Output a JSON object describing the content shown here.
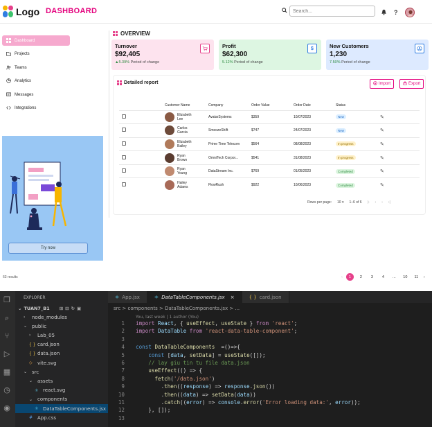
{
  "app": {
    "logo_text": "Logo",
    "page_title": "DASHBOARD",
    "search": {
      "placeholder": "Search..."
    },
    "colors": {
      "accent": "#e4007c",
      "active_nav": "#f6a9ce",
      "promo_bg": "#99c7f4"
    }
  },
  "sidebar": {
    "items": [
      {
        "label": "Dashboard",
        "icon": "grid-icon",
        "active": true
      },
      {
        "label": "Projects",
        "icon": "folder-icon"
      },
      {
        "label": "Teams",
        "icon": "users-icon"
      },
      {
        "label": "Analytics",
        "icon": "pie-chart-icon"
      },
      {
        "label": "Messages",
        "icon": "message-icon"
      },
      {
        "label": "Integrations",
        "icon": "code-icon"
      }
    ],
    "promo_button": "Try now"
  },
  "overview": {
    "title": "OVERVIEW",
    "cards": [
      {
        "title": "Turnover",
        "value": "$92,405",
        "change": "▲5.39%",
        "change_note": "Period of change",
        "icon": "cart-icon",
        "bg": "#fde3ee",
        "change_color": "#2b8a3e"
      },
      {
        "title": "Profit",
        "value": "$62,300",
        "change": "5.12%",
        "change_note": "Period of change",
        "icon": "dollar-icon",
        "bg": "#ddf6e2",
        "change_color": "#2b8a3e"
      },
      {
        "title": "New Customers",
        "value": "1,230",
        "change": "7.50%",
        "change_note": "Period of change",
        "icon": "user-circle-icon",
        "bg": "#ddeaff",
        "change_color": "#2b8a3e"
      }
    ]
  },
  "report": {
    "title": "Detailed report",
    "import_label": "Import",
    "export_label": "Export",
    "columns": [
      "Customer Name",
      "Company",
      "Order Value",
      "Order Date",
      "Status"
    ],
    "rows": [
      {
        "name": "Elizabeth Lee",
        "company": "AvatarSystems",
        "value": "$359",
        "date": "10/07/2023",
        "status": "New"
      },
      {
        "name": "Carlos Garcia",
        "company": "SmoozeShift",
        "value": "$747",
        "date": "24/07/2023",
        "status": "New"
      },
      {
        "name": "Elizabeth Bailey",
        "company": "Prime Time Telecom",
        "value": "$564",
        "date": "08/08/2023",
        "status": "In progress"
      },
      {
        "name": "Ryan Brown",
        "company": "OmniTech Corpor...",
        "value": "$541",
        "date": "31/08/2023",
        "status": "In progress"
      },
      {
        "name": "Ryan Young",
        "company": "DataStream Inc.",
        "value": "$769",
        "date": "01/05/2023",
        "status": "Completed"
      },
      {
        "name": "Hailey Adams",
        "company": "FlowRush",
        "value": "$922",
        "date": "10/06/2023",
        "status": "Completed"
      }
    ],
    "rows_per_page_label": "Rows per page:",
    "rows_per_page_value": "10",
    "range": "1–6 of 6"
  },
  "results_text": "63 results",
  "pagination": [
    "1",
    "2",
    "3",
    "4",
    "...",
    "10",
    "11"
  ],
  "vscode": {
    "explorer_title": "EXPLORER",
    "project": "TUAN7_B1",
    "tree": [
      {
        "label": "node_modules",
        "kind": "folder",
        "depth": 1
      },
      {
        "label": "public",
        "kind": "folder-open",
        "depth": 1
      },
      {
        "label": "Lab_05",
        "kind": "folder",
        "depth": 2
      },
      {
        "label": "card.json",
        "kind": "json",
        "depth": 2
      },
      {
        "label": "data.json",
        "kind": "json",
        "depth": 2
      },
      {
        "label": "vite.svg",
        "kind": "svg",
        "depth": 2
      },
      {
        "label": "src",
        "kind": "folder-open",
        "depth": 1
      },
      {
        "label": "assets",
        "kind": "folder-open",
        "depth": 2
      },
      {
        "label": "react.svg",
        "kind": "react",
        "depth": 3
      },
      {
        "label": "components",
        "kind": "folder-open",
        "depth": 2
      },
      {
        "label": "DataTableComponents.jsx",
        "kind": "react",
        "depth": 3,
        "selected": true
      },
      {
        "label": "App.css",
        "kind": "css",
        "depth": 2
      }
    ],
    "tabs": [
      {
        "label": "App.jsx",
        "active": false
      },
      {
        "label": "DataTableComponents.jsx",
        "active": true
      },
      {
        "label": "card.json",
        "active": false
      }
    ],
    "breadcrumb": "src > components > DataTableComponents.jsx > ...",
    "blame": "You, last week | 1 author (You)",
    "line_numbers": [
      "1",
      "2",
      "3",
      "4",
      "5",
      "6",
      "7",
      "8",
      "9",
      "10",
      "11",
      "12",
      "13"
    ]
  }
}
